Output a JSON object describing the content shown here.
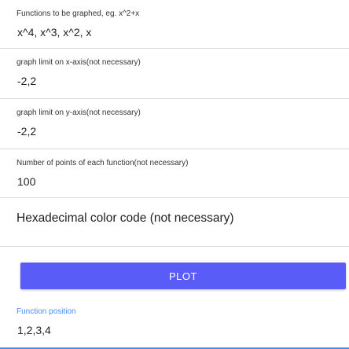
{
  "form": {
    "functions": {
      "label": "Functions to be graphed, eg. x^2+x",
      "value": "x^4, x^3, x^2, x"
    },
    "x_limit": {
      "label": "graph limit on x-axis(not necessary)",
      "value": "-2,2"
    },
    "y_limit": {
      "label": "graph limit on y-axis(not necessary)",
      "value": "-2,2"
    },
    "points": {
      "label": "Number of points of each function(not necessary)",
      "value": "100"
    },
    "color": {
      "placeholder": "Hexadecimal color code (not necessary)"
    },
    "plot_button": {
      "label": "PLOT"
    },
    "position": {
      "label": "Function position",
      "value": "1,2,3,4"
    }
  },
  "colors": {
    "accent": "#5a5cf8",
    "focus": "#4a8cf7"
  }
}
